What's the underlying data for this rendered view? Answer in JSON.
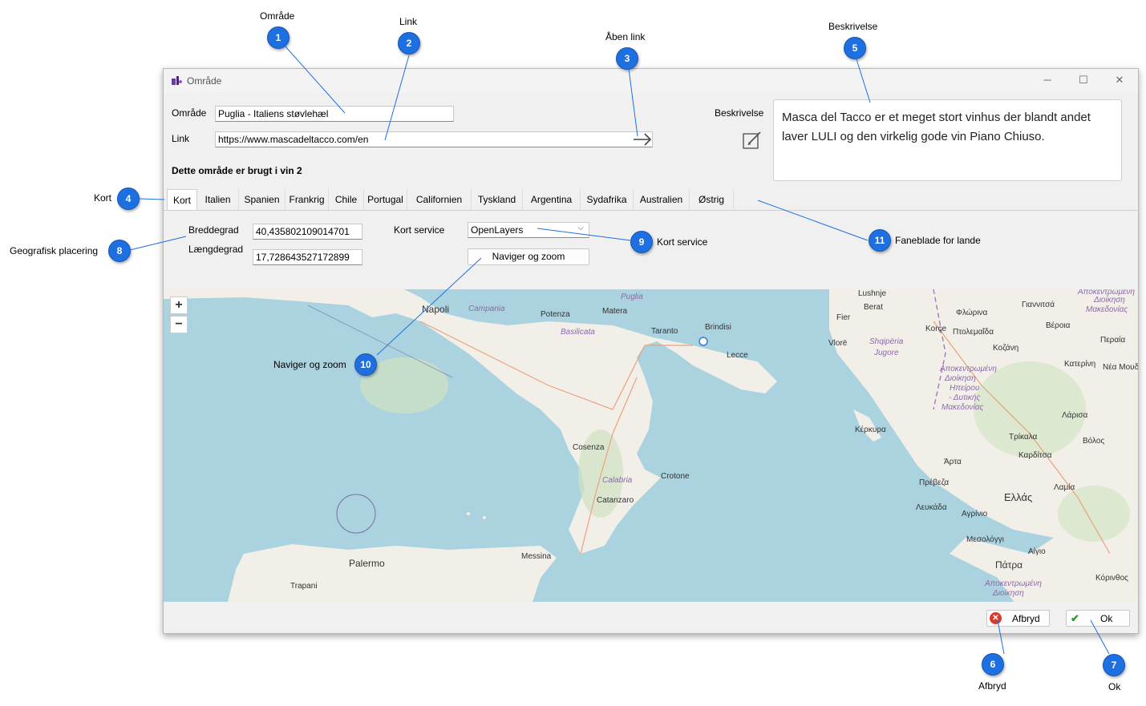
{
  "window": {
    "title": "Område",
    "controls": [
      "minimize-icon",
      "maximize-icon",
      "close-icon"
    ]
  },
  "form": {
    "area_label": "Område",
    "area_value": "Puglia - Italiens støvlehæl",
    "link_label": "Link",
    "link_value": "https://www.mascadeltacco.com/en",
    "usage_text": "Dette område er brugt i vin 2",
    "description_label": "Beskrivelse",
    "description_text": "Masca del Tacco er et meget stort vinhus der blandt andet laver LULI og den virkelig gode vin Piano Chiuso."
  },
  "tabs": [
    "Kort",
    "Italien",
    "Spanien",
    "Frankrig",
    "Chile",
    "Portugal",
    "Californien",
    "Tyskland",
    "Argentina",
    "Sydafrika",
    "Australien",
    "Østrig"
  ],
  "active_tab": 0,
  "map_panel": {
    "latitude_label": "Breddegrad",
    "latitude_value": "40,435802109014701",
    "longitude_label": "Længdegrad",
    "longitude_value": "17,728643527172899",
    "service_label": "Kort service",
    "service_value": "OpenLayers",
    "navigate_button": "Naviger og zoom",
    "zoom_in": "+",
    "zoom_out": "−"
  },
  "map_labels": {
    "napoli": "Napoli",
    "campania": "Campania",
    "puglia": "Puglia",
    "potenza": "Potenza",
    "matera": "Matera",
    "basilicata": "Basilicata",
    "taranto": "Taranto",
    "brindisi": "Brindisi",
    "lecce": "Lecce",
    "cosenza": "Cosenza",
    "calabria": "Calabria",
    "crotone": "Crotone",
    "catanzaro": "Catanzaro",
    "messina": "Messina",
    "palermo": "Palermo",
    "trapani": "Trapani",
    "lushnje": "Lushnje",
    "berat": "Berat",
    "fier": "Fier",
    "vlore": "Vlorë",
    "korce": "Korçe",
    "shqiperia": "Shqipëria",
    "jugore": "Jugore",
    "florina": "Φλώρινα",
    "ptolemaida": "Πτολεμαΐδα",
    "kozani": "Κοζάνη",
    "giannitsa": "Γιαννιτσά",
    "veroia": "Βέροια",
    "pieria": "Περαία",
    "katerini": "Κατερίνη",
    "nea_moud": "Νέα Μουδ",
    "kerkyra": "Κέρκυρα",
    "apok1": "Αποκεντρωμένη",
    "dioikisi1": "Διοίκηση",
    "ipeirou": "Ηπείρου",
    "dytikis": "- Δυτικής",
    "makedonias": "Μακεδονίας",
    "apok_top": "Αποκεντρωμένη",
    "dioikisi_top": "Διοίκηση",
    "makedonias_top": "Μακεδονίας",
    "larisa": "Λάρισα",
    "trikala": "Τρίκαλα",
    "karditsa": "Καρδίτσα",
    "volos": "Βόλος",
    "arta": "Άρτα",
    "preveza": "Πρέβεζα",
    "lamia": "Λαμία",
    "ellas": "Ελλάς",
    "lefkada": "Λευκάδα",
    "agrinio": "Αγρίνιο",
    "mesolongi": "Μεσολόγγι",
    "aigio": "Αίγιο",
    "patra": "Πάτρα",
    "korinthos": "Κόρινθος",
    "apok2": "Αποκεντρωμένη",
    "dioikisi2": "Διοίκηση"
  },
  "footer": {
    "cancel_label": "Afbryd",
    "ok_label": "Ok"
  },
  "callouts": [
    {
      "number": "1",
      "label": "Område"
    },
    {
      "number": "2",
      "label": "Link"
    },
    {
      "number": "3",
      "label": "Åben link"
    },
    {
      "number": "4",
      "label": "Kort"
    },
    {
      "number": "5",
      "label": "Beskrivelse"
    },
    {
      "number": "6",
      "label": "Afbryd"
    },
    {
      "number": "7",
      "label": "Ok"
    },
    {
      "number": "8",
      "label": "Geografisk placering"
    },
    {
      "number": "9",
      "label": "Kort service"
    },
    {
      "number": "10",
      "label": "Naviger og zoom"
    },
    {
      "number": "11",
      "label": "Faneblade for lande"
    }
  ],
  "colors": {
    "badge": "#1e6fe0",
    "callout_line": "#1e6fe0",
    "sea": "#aad3df",
    "land": "#f2efe9"
  }
}
